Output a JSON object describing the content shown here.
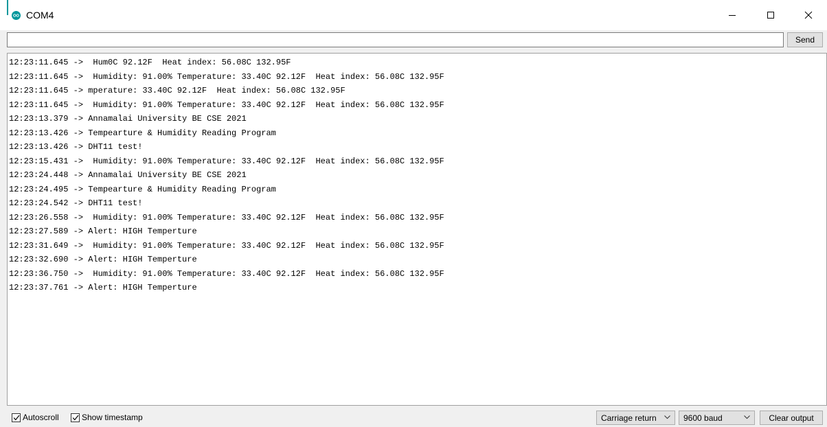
{
  "window": {
    "title": "COM4",
    "accent_color": "#00979c",
    "icons": {
      "app": "arduino-icon",
      "minimize": "minimize-icon",
      "maximize": "maximize-icon",
      "close": "close-icon"
    }
  },
  "input": {
    "value": "",
    "send_label": "Send"
  },
  "output": {
    "lines": [
      "12:23:11.645 ->  Hum0C 92.12F  Heat index: 56.08C 132.95F",
      "12:23:11.645 ->  Humidity: 91.00% Temperature: 33.40C 92.12F  Heat index: 56.08C 132.95F",
      "12:23:11.645 -> mperature: 33.40C 92.12F  Heat index: 56.08C 132.95F",
      "12:23:11.645 ->  Humidity: 91.00% Temperature: 33.40C 92.12F  Heat index: 56.08C 132.95F",
      "12:23:13.379 -> Annamalai University BE CSE 2021",
      "12:23:13.426 -> Tempearture & Humidity Reading Program",
      "12:23:13.426 -> DHT11 test!",
      "12:23:15.431 ->  Humidity: 91.00% Temperature: 33.40C 92.12F  Heat index: 56.08C 132.95F",
      "12:23:24.448 -> Annamalai University BE CSE 2021",
      "12:23:24.495 -> Tempearture & Humidity Reading Program",
      "12:23:24.542 -> DHT11 test!",
      "12:23:26.558 ->  Humidity: 91.00% Temperature: 33.40C 92.12F  Heat index: 56.08C 132.95F",
      "12:23:27.589 -> Alert: HIGH Temperture",
      "12:23:31.649 ->  Humidity: 91.00% Temperature: 33.40C 92.12F  Heat index: 56.08C 132.95F",
      "12:23:32.690 -> Alert: HIGH Temperture",
      "12:23:36.750 ->  Humidity: 91.00% Temperature: 33.40C 92.12F  Heat index: 56.08C 132.95F",
      "12:23:37.761 -> Alert: HIGH Temperture"
    ]
  },
  "statusbar": {
    "autoscroll": {
      "label": "Autoscroll",
      "checked": true
    },
    "show_timestamp": {
      "label": "Show timestamp",
      "checked": true
    },
    "line_ending": "Carriage return",
    "baud_rate": "9600 baud",
    "clear_label": "Clear output"
  }
}
